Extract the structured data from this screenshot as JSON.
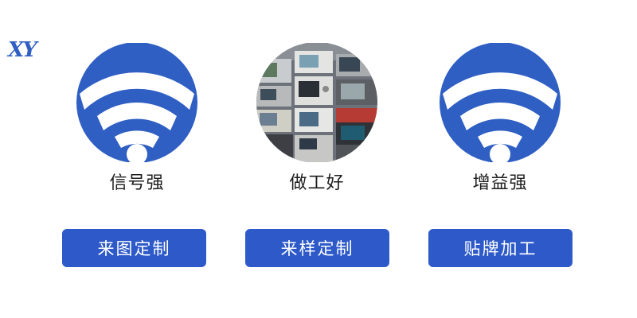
{
  "logo": {
    "text": "XY"
  },
  "features": [
    {
      "label": "信号强",
      "icon": "wifi-signal-icon"
    },
    {
      "label": "做工好",
      "icon": "test-equipment-photo"
    },
    {
      "label": "增益强",
      "icon": "wifi-signal-icon"
    }
  ],
  "buttons": [
    {
      "label": "来图定制"
    },
    {
      "label": "来样定制"
    },
    {
      "label": "贴牌加工"
    }
  ],
  "colors": {
    "accent": "#2d59c9",
    "icon_blue": "#2f5fc3",
    "label_text": "#1e1e1e",
    "background": "#ffffff"
  }
}
